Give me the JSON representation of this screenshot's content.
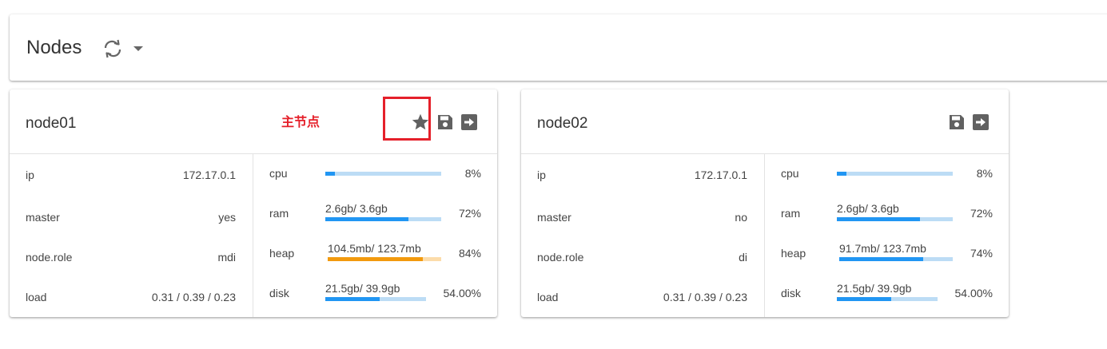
{
  "header": {
    "title": "Nodes"
  },
  "annotation": {
    "label": "主节点"
  },
  "nodes": [
    {
      "name": "node01",
      "is_master_marker": true,
      "info": [
        {
          "key": "ip",
          "value": "172.17.0.1"
        },
        {
          "key": "master",
          "value": "yes"
        },
        {
          "key": "node.role",
          "value": "mdi"
        },
        {
          "key": "load",
          "value": "0.31 / 0.39 / 0.23"
        }
      ],
      "metrics": [
        {
          "label": "cpu",
          "text": "",
          "percent_label": "8%",
          "fraction": 0.08,
          "status": "normal"
        },
        {
          "label": "ram",
          "text": "2.6gb/ 3.6gb",
          "percent_label": "72%",
          "fraction": 0.72,
          "status": "normal"
        },
        {
          "label": "heap",
          "text": "104.5mb/ 123.7mb",
          "percent_label": "84%",
          "fraction": 0.84,
          "status": "warning"
        },
        {
          "label": "disk",
          "text": "21.5gb/ 39.9gb",
          "percent_label": "54.00%",
          "fraction": 0.54,
          "status": "normal"
        }
      ]
    },
    {
      "name": "node02",
      "is_master_marker": false,
      "info": [
        {
          "key": "ip",
          "value": "172.17.0.1"
        },
        {
          "key": "master",
          "value": "no"
        },
        {
          "key": "node.role",
          "value": "di"
        },
        {
          "key": "load",
          "value": "0.31 / 0.39 / 0.23"
        }
      ],
      "metrics": [
        {
          "label": "cpu",
          "text": "",
          "percent_label": "8%",
          "fraction": 0.08,
          "status": "normal"
        },
        {
          "label": "ram",
          "text": "2.6gb/ 3.6gb",
          "percent_label": "72%",
          "fraction": 0.72,
          "status": "normal"
        },
        {
          "label": "heap",
          "text": "91.7mb/ 123.7mb",
          "percent_label": "74%",
          "fraction": 0.74,
          "status": "normal"
        },
        {
          "label": "disk",
          "text": "21.5gb/ 39.9gb",
          "percent_label": "54.00%",
          "fraction": 0.54,
          "status": "normal"
        }
      ]
    }
  ],
  "colors": {
    "bar_fill": "#2196f3",
    "bar_track": "#bcdcf5",
    "warning_fill": "#f29a0e",
    "warning_track": "#fcdcaa",
    "annotation": "#e5202a",
    "icon": "#616161"
  },
  "icons": [
    "refresh-icon",
    "dropdown-caret-icon",
    "star-icon",
    "save-icon",
    "exit-icon"
  ]
}
